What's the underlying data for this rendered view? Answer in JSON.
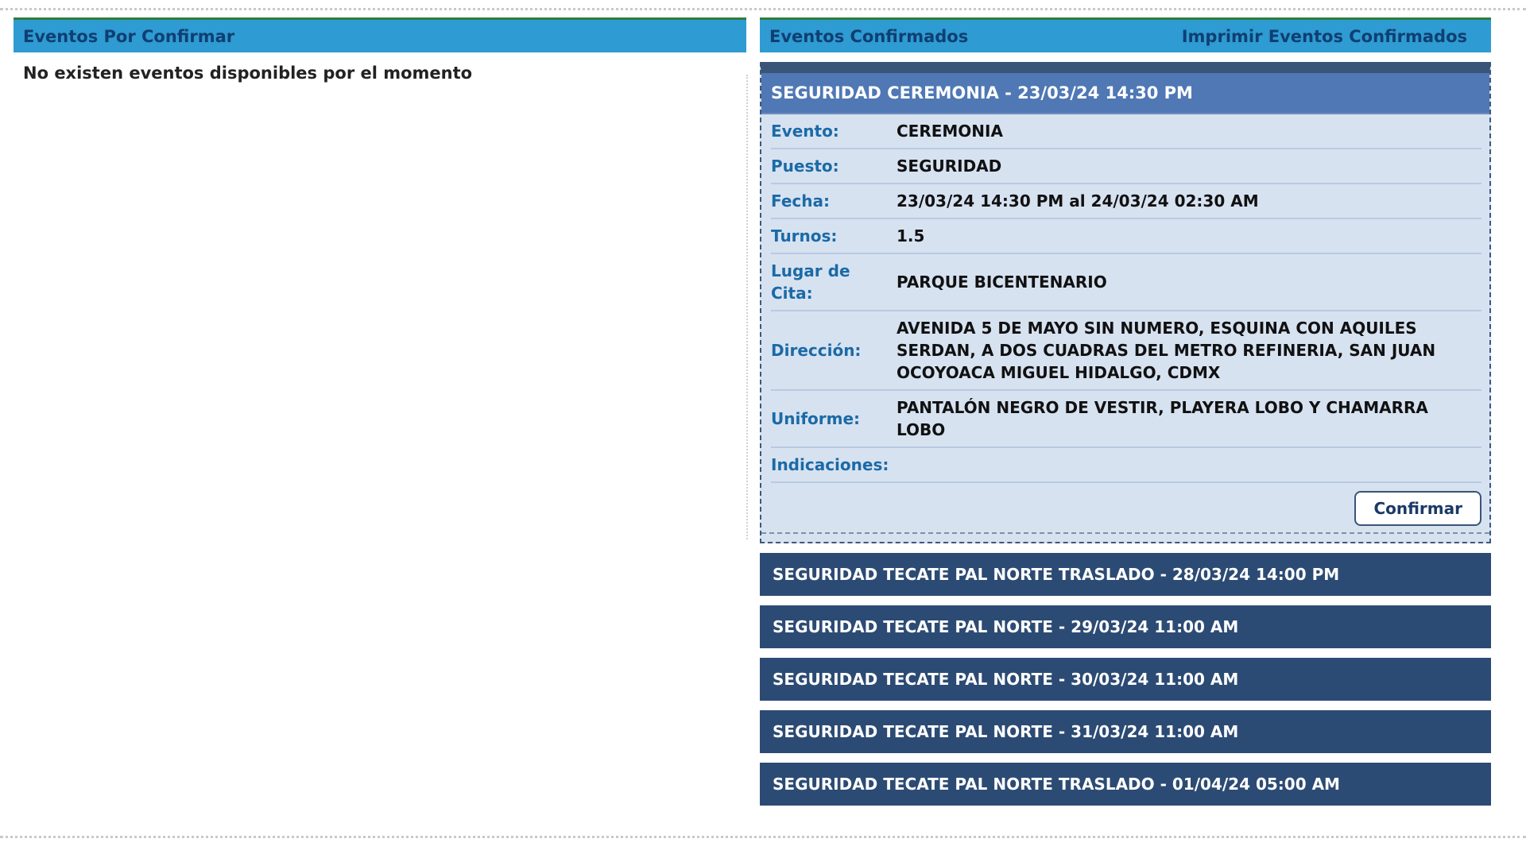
{
  "left_panel": {
    "header": "Eventos Por Confirmar",
    "empty_message": "No existen eventos disponibles por el momento"
  },
  "right_panel": {
    "header": "Eventos Confirmados",
    "print_link": "Imprimir Eventos Confirmados",
    "expanded_event": {
      "title": "SEGURIDAD CEREMONIA - 23/03/24 14:30 PM",
      "details": [
        {
          "label": "Evento:",
          "value": "CEREMONIA"
        },
        {
          "label": "Puesto:",
          "value": "SEGURIDAD"
        },
        {
          "label": "Fecha:",
          "value": "23/03/24 14:30 PM al 24/03/24 02:30 AM"
        },
        {
          "label": "Turnos:",
          "value": "1.5"
        },
        {
          "label": "Lugar de Cita:",
          "value": "PARQUE BICENTENARIO"
        },
        {
          "label": "Dirección:",
          "value": "AVENIDA 5 DE MAYO SIN NUMERO, ESQUINA CON AQUILES SERDAN, A DOS CUADRAS DEL METRO REFINERIA, SAN JUAN OCOYOACA MIGUEL HIDALGO, CDMX"
        },
        {
          "label": "Uniforme:",
          "value": "PANTALÓN NEGRO DE VESTIR, PLAYERA LOBO Y CHAMARRA LOBO"
        },
        {
          "label": "Indicaciones:",
          "value": ""
        }
      ],
      "confirm_button": "Confirmar"
    },
    "events": [
      "SEGURIDAD TECATE PAL NORTE TRASLADO - 28/03/24 14:00 PM",
      "SEGURIDAD TECATE PAL NORTE - 29/03/24 11:00 AM",
      "SEGURIDAD TECATE PAL NORTE - 30/03/24 11:00 AM",
      "SEGURIDAD TECATE PAL NORTE - 31/03/24 11:00 AM",
      "SEGURIDAD TECATE PAL NORTE TRASLADO - 01/04/24 05:00 AM"
    ]
  },
  "colors": {
    "header_bg": "#2e9bd2",
    "header_text": "#0f3f72",
    "card_title_bg": "#4f78b4",
    "card_bg": "#d7e2f1",
    "event_bar_bg": "#2c4b74"
  }
}
